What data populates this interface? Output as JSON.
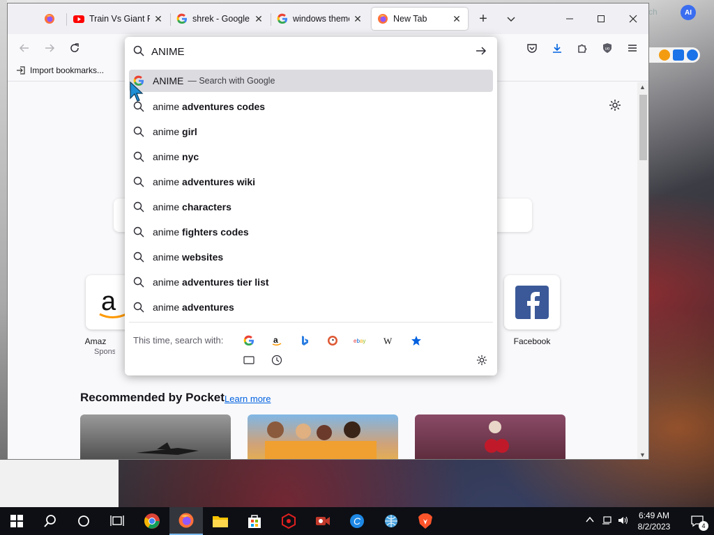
{
  "desktop": {
    "background_search_text": "ch",
    "ai_badge": "AI",
    "colors": {
      "accent": "#0061e0",
      "selection": "#dcdce0",
      "taskbar": "#0d0f14"
    }
  },
  "tabs": [
    {
      "title": "",
      "icon": "firefox-icon"
    },
    {
      "title": "Train Vs Giant Pit",
      "icon": "youtube-icon"
    },
    {
      "title": "shrek - Google Sea",
      "icon": "google-icon"
    },
    {
      "title": "windows theme",
      "icon": "google-icon"
    },
    {
      "title": "New Tab",
      "icon": "firefox-icon",
      "active": true
    }
  ],
  "tab_controls": {
    "new_tab": "+",
    "list_all": "⌵"
  },
  "window_controls": {
    "minimize": "—",
    "maximize": "☐",
    "close": "✕"
  },
  "bookmarks": {
    "import_label": "Import bookmarks..."
  },
  "urlbar": {
    "query": "ANIME",
    "action_text": "— Search with Google",
    "suggestions": [
      {
        "prefix": "anime",
        "bold": "adventures codes"
      },
      {
        "prefix": "anime",
        "bold": "girl"
      },
      {
        "prefix": "anime",
        "bold": "nyc"
      },
      {
        "prefix": "anime",
        "bold": "adventures wiki"
      },
      {
        "prefix": "anime",
        "bold": "characters"
      },
      {
        "prefix": "anime",
        "bold": "fighters codes"
      },
      {
        "prefix": "anime",
        "bold": "websites"
      },
      {
        "prefix": "anime",
        "bold": "adventures tier list"
      },
      {
        "prefix": "anime",
        "bold": "adventures"
      }
    ],
    "one_off_label": "This time, search with:",
    "engines": [
      "google",
      "amazon",
      "bing",
      "duckduckgo",
      "ebay",
      "wikipedia",
      "bookmarks"
    ]
  },
  "new_tab_page": {
    "topsites": [
      {
        "label": "Amaz",
        "sub": "Spons"
      },
      {
        "label": "Facebook"
      }
    ],
    "pocket_title": "Recommended by Pocket",
    "pocket_learn_more": "Learn more"
  },
  "taskbar": {
    "time": "6:49 AM",
    "date": "8/2/2023",
    "notification_count": "4"
  }
}
